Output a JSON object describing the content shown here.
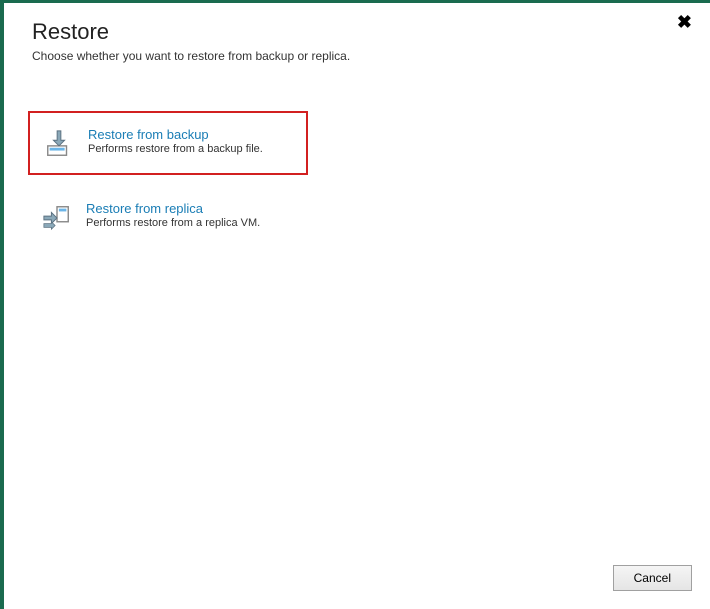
{
  "header": {
    "title": "Restore",
    "subtitle": "Choose whether you want to restore from backup or replica."
  },
  "options": [
    {
      "title": "Restore from backup",
      "desc": "Performs restore from a backup file.",
      "icon": "restore-backup-icon",
      "selected": true
    },
    {
      "title": "Restore from replica",
      "desc": "Performs restore from a replica VM.",
      "icon": "restore-replica-icon",
      "selected": false
    }
  ],
  "footer": {
    "cancel_label": "Cancel"
  },
  "close_label": "✖"
}
